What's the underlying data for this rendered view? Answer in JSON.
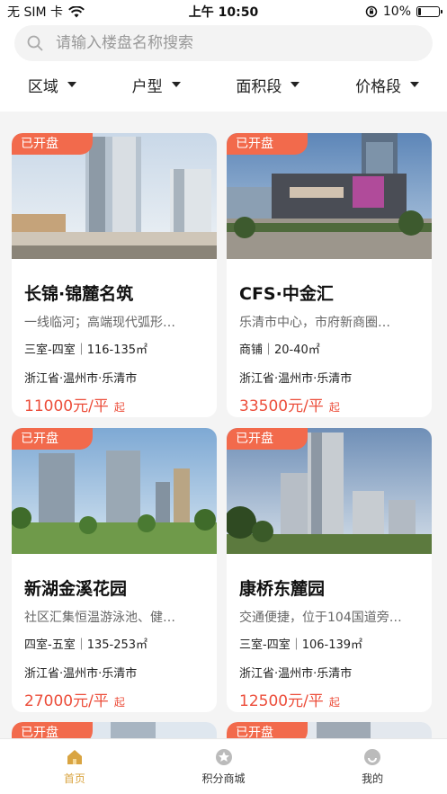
{
  "status_bar": {
    "carrier": "无 SIM 卡",
    "time": "上午 10:50",
    "battery": "10%"
  },
  "search": {
    "placeholder": "请输入楼盘名称搜索"
  },
  "filters": [
    {
      "label": "区域"
    },
    {
      "label": "户型"
    },
    {
      "label": "面积段"
    },
    {
      "label": "价格段"
    }
  ],
  "listings": [
    {
      "badge": "已开盘",
      "name": "长锦·锦麓名筑",
      "desc": "一线临河；高端现代弧形…",
      "spec": "三室-四室｜116-135㎡",
      "location": "浙江省·温州市·乐清市",
      "price": "11000元/平",
      "price_suffix": "起"
    },
    {
      "badge": "已开盘",
      "name": "CFS·中金汇",
      "desc": "乐清市中心，市府新商圈…",
      "spec": "商铺｜20-40㎡",
      "location": "浙江省·温州市·乐清市",
      "price": "33500元/平",
      "price_suffix": "起"
    },
    {
      "badge": "已开盘",
      "name": "新湖金溪花园",
      "desc": "社区汇集恒温游泳池、健…",
      "spec": "四室-五室｜135-253㎡",
      "location": "浙江省·温州市·乐清市",
      "price": "27000元/平",
      "price_suffix": "起"
    },
    {
      "badge": "已开盘",
      "name": "康桥东麓园",
      "desc": "交通便捷，位于104国道旁…",
      "spec": "三室-四室｜106-139㎡",
      "location": "浙江省·温州市·乐清市",
      "price": "12500元/平",
      "price_suffix": "起"
    }
  ],
  "partial_badges": [
    "已开盘",
    "已开盘"
  ],
  "tabbar": [
    {
      "label": "首页",
      "icon": "home-icon",
      "active": true
    },
    {
      "label": "积分商城",
      "icon": "points-mall-icon",
      "active": false
    },
    {
      "label": "我的",
      "icon": "profile-icon",
      "active": false
    }
  ],
  "colors": {
    "accent": "#f26a4c",
    "price": "#ec4d3a",
    "tab_active": "#d9a441"
  }
}
